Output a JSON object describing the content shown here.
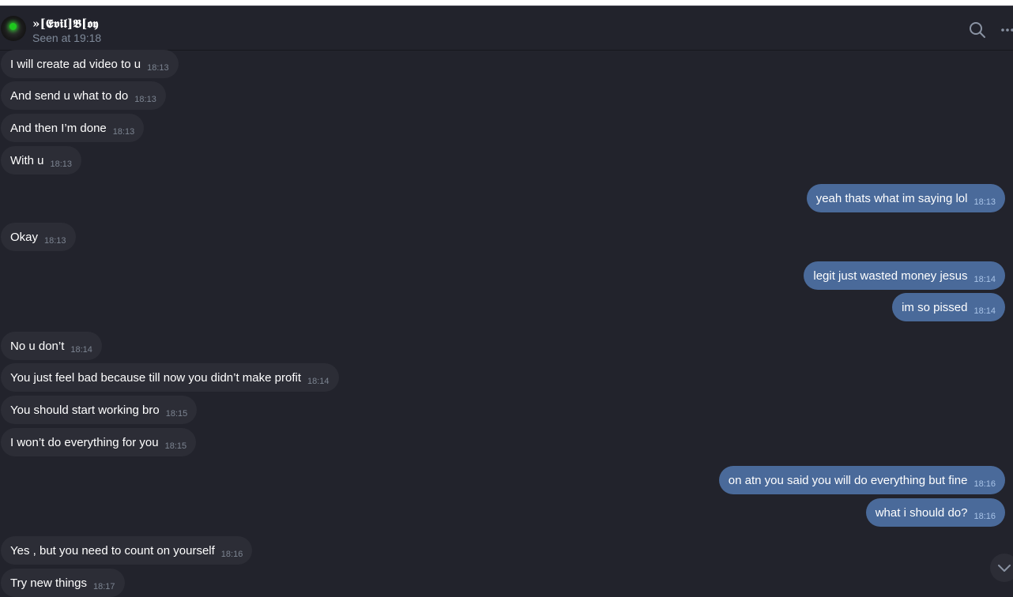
{
  "contact": {
    "name": "»[𝕰𝖛𝖎𝖑]𝕭[𝖔𝖞",
    "status": "Seen at 19:18"
  },
  "icons": {
    "avatar": "avatar-image",
    "search": "search-icon",
    "more": "more-icon",
    "scroll_down": "chevron-down-icon"
  },
  "colors": {
    "background": "#22232c",
    "incoming_bubble": "#2c2d36",
    "outgoing_bubble": "#4a6a9a"
  },
  "messages": [
    {
      "text": "I will create ad video to u",
      "time": "18:13"
    },
    {
      "text": "And send u what to do",
      "time": "18:13"
    },
    {
      "text": "And then I’m done",
      "time": "18:13"
    },
    {
      "text": "With u",
      "time": "18:13"
    },
    {
      "text": "yeah thats what im saying lol",
      "time": "18:13"
    },
    {
      "text": "Okay",
      "time": "18:13"
    },
    {
      "text": "legit just wasted money jesus",
      "time": "18:14"
    },
    {
      "text": "im so pissed",
      "time": "18:14"
    },
    {
      "text": "No u don’t",
      "time": "18:14"
    },
    {
      "text": "You just feel bad because till now you didn’t make profit",
      "time": "18:14"
    },
    {
      "text": "You should start working bro",
      "time": "18:15"
    },
    {
      "text": "I won’t do everything for you",
      "time": "18:15"
    },
    {
      "text": "on atn you said you will do everything but fine",
      "time": "18:16"
    },
    {
      "text": "what i should do?",
      "time": "18:16"
    },
    {
      "text": "Yes , but you need to count on yourself",
      "time": "18:16"
    },
    {
      "text": "Try new things",
      "time": "18:17"
    }
  ]
}
